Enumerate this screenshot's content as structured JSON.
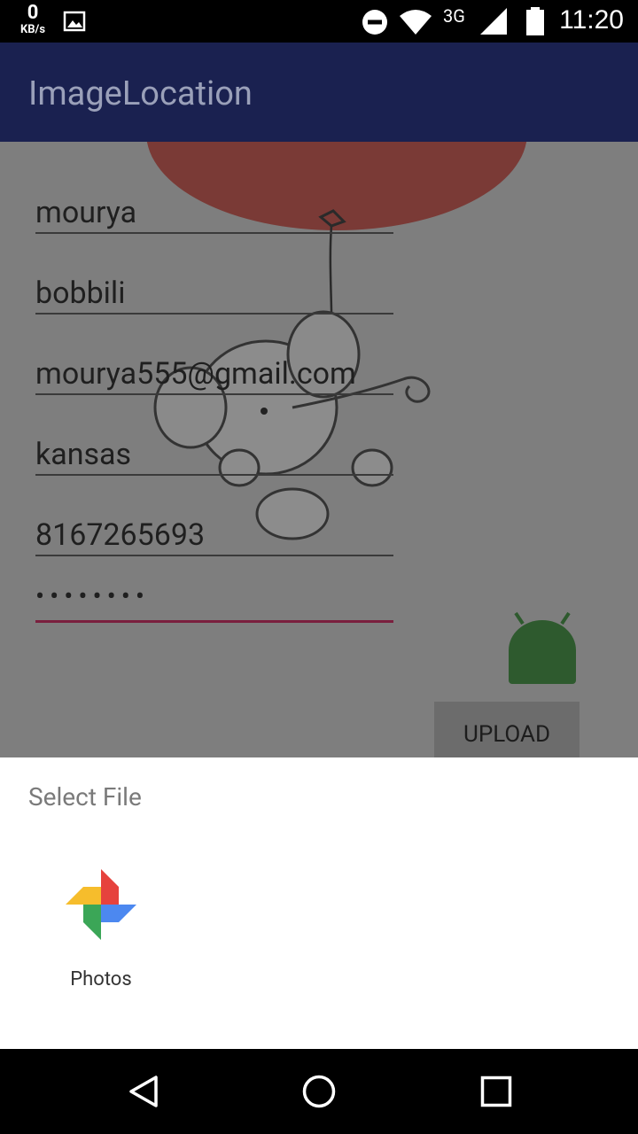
{
  "status_bar": {
    "speed_value": "0",
    "speed_unit": "KB/s",
    "network": "3G",
    "time": "11:20"
  },
  "app_bar": {
    "title": "ImageLocation"
  },
  "form": {
    "first_name": "mourya",
    "last_name": "bobbili",
    "email": "mourya555@gmail.com",
    "city": "kansas",
    "phone": "8167265693",
    "password_mask": "••••••••",
    "upload_label": "UPLOAD"
  },
  "sheet": {
    "title": "Select File",
    "options": [
      {
        "label": "Photos",
        "icon": "google-photos-icon"
      }
    ]
  },
  "navbar": {
    "back_icon": "back-icon",
    "home_icon": "home-icon",
    "recents_icon": "recents-icon"
  }
}
